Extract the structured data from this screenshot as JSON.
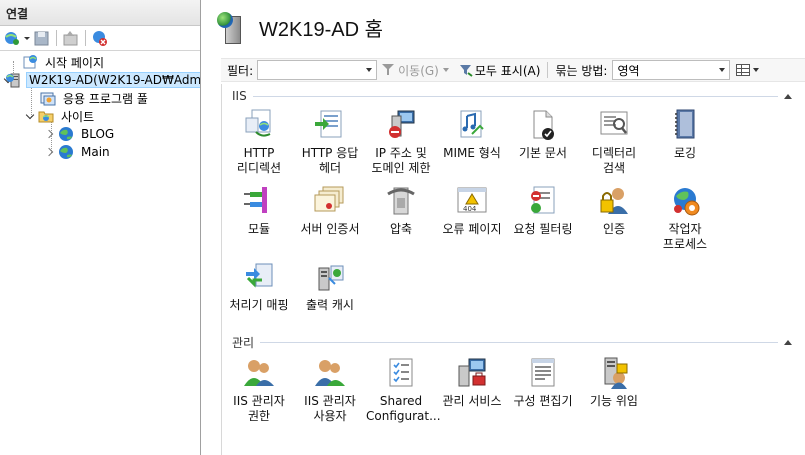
{
  "left_pane": {
    "title": "연결",
    "toolbar": {
      "icons": [
        "connect-globe-icon",
        "save-icon",
        "up-icon",
        "disconnect-icon"
      ]
    },
    "tree": [
      {
        "label": "시작 페이지",
        "level": 0,
        "icon": "start-page-icon"
      },
      {
        "label": "W2K19-AD(W2K19-AD₩Adm",
        "level": 0,
        "icon": "server-icon",
        "expanded": true,
        "selected": true
      },
      {
        "label": "응용 프로그램 풀",
        "level": 1,
        "icon": "app-pool-icon"
      },
      {
        "label": "사이트",
        "level": 1,
        "icon": "sites-folder-icon",
        "expanded": true
      },
      {
        "label": "BLOG",
        "level": 2,
        "icon": "site-globe-icon"
      },
      {
        "label": "Main",
        "level": 2,
        "icon": "site-globe-icon"
      }
    ]
  },
  "header": {
    "title": "W2K19-AD 홈"
  },
  "filterbar": {
    "filter_label": "필터:",
    "filter_value": "",
    "go_label": "이동(G)",
    "show_all_label": "모두 표시(A)",
    "group_by_label": "묶는 방법:",
    "group_by_value": "영역"
  },
  "groups": {
    "iis": {
      "title": "IIS",
      "items": [
        {
          "label": "HTTP\n리디렉션",
          "icon": "http-redirect-icon"
        },
        {
          "label": "HTTP 응답\n헤더",
          "icon": "http-response-headers-icon"
        },
        {
          "label": "IP 주소 및\n도메인 제한",
          "icon": "ip-restrictions-icon"
        },
        {
          "label": "MIME 형식",
          "icon": "mime-types-icon"
        },
        {
          "label": "기본 문서",
          "icon": "default-document-icon"
        },
        {
          "label": "디렉터리\n검색",
          "icon": "directory-browsing-icon"
        },
        {
          "label": "로깅",
          "icon": "logging-icon"
        },
        {
          "label": "모듈",
          "icon": "modules-icon"
        },
        {
          "label": "서버 인증서",
          "icon": "server-certificates-icon"
        },
        {
          "label": "압축",
          "icon": "compression-icon"
        },
        {
          "label": "오류 페이지",
          "icon": "error-pages-icon"
        },
        {
          "label": "요청 필터링",
          "icon": "request-filtering-icon"
        },
        {
          "label": "인증",
          "icon": "authentication-icon"
        },
        {
          "label": "작업자\n프로세스",
          "icon": "worker-processes-icon"
        },
        {
          "label": "처리기 매핑",
          "icon": "handler-mappings-icon"
        },
        {
          "label": "출력 캐시",
          "icon": "output-caching-icon"
        }
      ]
    },
    "management": {
      "title": "관리",
      "items": [
        {
          "label": "IIS 관리자\n권한",
          "icon": "iis-manager-permissions-icon"
        },
        {
          "label": "IIS 관리자\n사용자",
          "icon": "iis-manager-users-icon"
        },
        {
          "label": "Shared\nConfigurat...",
          "icon": "shared-configuration-icon"
        },
        {
          "label": "관리 서비스",
          "icon": "management-service-icon"
        },
        {
          "label": "구성 편집기",
          "icon": "configuration-editor-icon"
        },
        {
          "label": "기능 위임",
          "icon": "feature-delegation-icon"
        }
      ]
    }
  }
}
